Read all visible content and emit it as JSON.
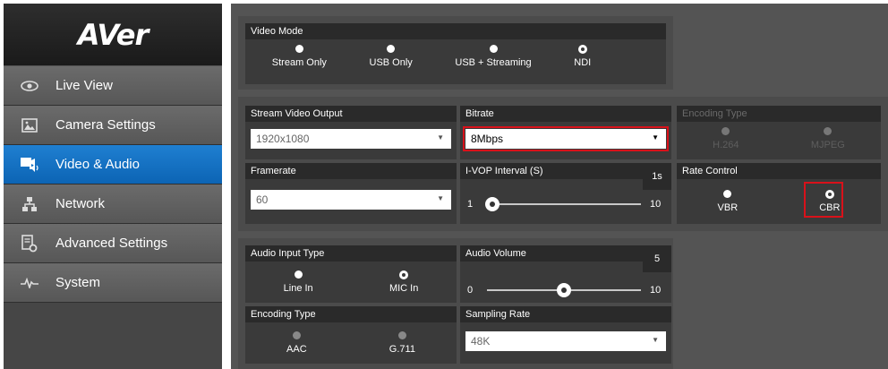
{
  "brand": {
    "logo": "AVer"
  },
  "sidebar": {
    "items": [
      {
        "label": "Live View",
        "icon": "eye-icon"
      },
      {
        "label": "Camera Settings",
        "icon": "image-icon"
      },
      {
        "label": "Video & Audio",
        "icon": "video-audio-icon",
        "active": true
      },
      {
        "label": "Network",
        "icon": "network-icon"
      },
      {
        "label": "Advanced Settings",
        "icon": "settings-doc-icon"
      },
      {
        "label": "System",
        "icon": "pulse-icon"
      }
    ]
  },
  "video_mode": {
    "title": "Video Mode",
    "options": [
      "Stream Only",
      "USB Only",
      "USB + Streaming",
      "NDI"
    ],
    "selected": "NDI"
  },
  "stream_video_output": {
    "title": "Stream Video Output",
    "value": "1920x1080"
  },
  "bitrate": {
    "title": "Bitrate",
    "value": "8Mbps"
  },
  "encoding_type_video": {
    "title": "Encoding Type",
    "options": [
      "H.264",
      "MJPEG"
    ],
    "disabled": true
  },
  "framerate": {
    "title": "Framerate",
    "value": "60"
  },
  "ivop": {
    "title": "I-VOP Interval (S)",
    "value": "1s",
    "min": "1",
    "max": "10",
    "level": 1
  },
  "rate_control": {
    "title": "Rate Control",
    "options": [
      "VBR",
      "CBR"
    ],
    "selected": "CBR"
  },
  "audio_input_type": {
    "title": "Audio Input Type",
    "options": [
      "Line In",
      "MIC In"
    ],
    "selected": "MIC In"
  },
  "audio_volume": {
    "title": "Audio Volume",
    "value": "5",
    "min": "0",
    "max": "10",
    "level": 5
  },
  "encoding_type_audio": {
    "title": "Encoding Type",
    "options": [
      "AAC",
      "G.711"
    ],
    "disabled": true
  },
  "sampling_rate": {
    "title": "Sampling Rate",
    "value": "48K"
  },
  "colors": {
    "active_nav": "#0c64b4",
    "highlight": "#d9111a"
  }
}
